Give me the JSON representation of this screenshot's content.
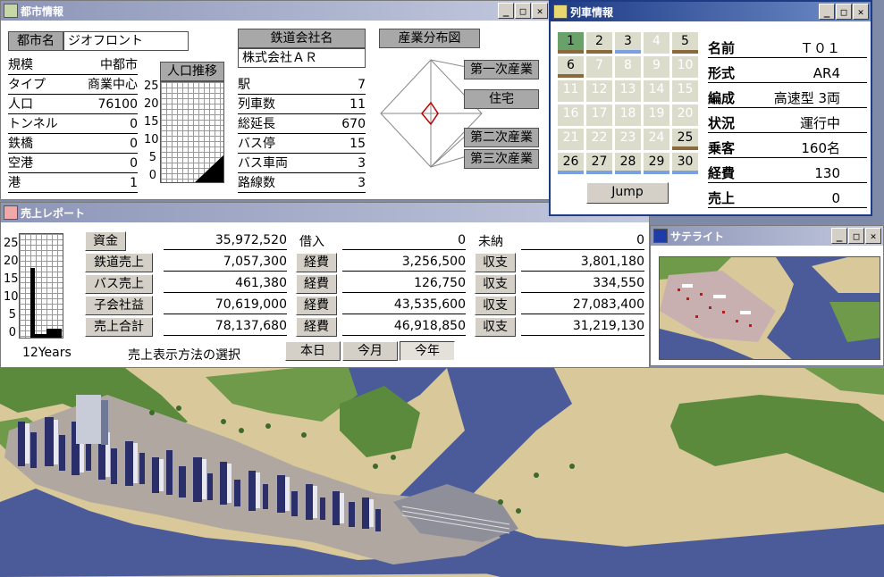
{
  "city_window": {
    "title": "都市情報",
    "city_name_label": "都市名",
    "city_name": "ジオフロント",
    "stats": [
      {
        "label": "規模",
        "value": "中都市"
      },
      {
        "label": "タイプ",
        "value": "商業中心"
      },
      {
        "label": "人口",
        "value": "76100"
      },
      {
        "label": "トンネル",
        "value": "0"
      },
      {
        "label": "鉄橋",
        "value": "0"
      },
      {
        "label": "空港",
        "value": "0"
      },
      {
        "label": "港",
        "value": "1"
      }
    ],
    "population_chart_label": "人口推移",
    "population_axis": [
      "25",
      "20",
      "15",
      "10",
      "5",
      "0"
    ],
    "railway_company_label": "鉄道会社名",
    "railway_company": "株式会社ＡＲ",
    "rail_stats": [
      {
        "label": "駅",
        "value": "7"
      },
      {
        "label": "列車数",
        "value": "11"
      },
      {
        "label": "総延長",
        "value": "670"
      },
      {
        "label": "バス停",
        "value": "15"
      },
      {
        "label": "バス車両",
        "value": "3"
      },
      {
        "label": "路線数",
        "value": "3"
      }
    ],
    "industry_map_label": "産業分布図",
    "industry_labels": [
      "第一次産業",
      "住宅",
      "第二次産業",
      "第三次産業"
    ]
  },
  "train_window": {
    "title": "列車情報",
    "cells": [
      {
        "n": "1",
        "state": "sel",
        "bar": "#8a6a3a"
      },
      {
        "n": "2",
        "state": "on",
        "bar": "#8a6a3a"
      },
      {
        "n": "3",
        "state": "on",
        "bar": "#7aa0e0"
      },
      {
        "n": "4",
        "state": "dim",
        "bar": ""
      },
      {
        "n": "5",
        "state": "on",
        "bar": "#8a6a3a"
      },
      {
        "n": "6",
        "state": "on",
        "bar": "#8a6a3a"
      },
      {
        "n": "7",
        "state": "dim",
        "bar": ""
      },
      {
        "n": "8",
        "state": "dim",
        "bar": ""
      },
      {
        "n": "9",
        "state": "dim",
        "bar": ""
      },
      {
        "n": "10",
        "state": "dim",
        "bar": ""
      },
      {
        "n": "11",
        "state": "dim",
        "bar": ""
      },
      {
        "n": "12",
        "state": "dim",
        "bar": ""
      },
      {
        "n": "13",
        "state": "dim",
        "bar": ""
      },
      {
        "n": "14",
        "state": "dim",
        "bar": ""
      },
      {
        "n": "15",
        "state": "dim",
        "bar": ""
      },
      {
        "n": "16",
        "state": "dim",
        "bar": ""
      },
      {
        "n": "17",
        "state": "dim",
        "bar": ""
      },
      {
        "n": "18",
        "state": "dim",
        "bar": ""
      },
      {
        "n": "19",
        "state": "dim",
        "bar": ""
      },
      {
        "n": "20",
        "state": "dim",
        "bar": ""
      },
      {
        "n": "21",
        "state": "dim",
        "bar": ""
      },
      {
        "n": "22",
        "state": "dim",
        "bar": ""
      },
      {
        "n": "23",
        "state": "dim",
        "bar": ""
      },
      {
        "n": "24",
        "state": "dim",
        "bar": ""
      },
      {
        "n": "25",
        "state": "on",
        "bar": "#8a6a3a"
      },
      {
        "n": "26",
        "state": "on",
        "bar": "#7aa0e0"
      },
      {
        "n": "27",
        "state": "on",
        "bar": "#7aa0e0"
      },
      {
        "n": "28",
        "state": "on",
        "bar": "#7aa0e0"
      },
      {
        "n": "29",
        "state": "on",
        "bar": "#7aa0e0"
      },
      {
        "n": "30",
        "state": "on",
        "bar": "#7aa0e0"
      }
    ],
    "jump_label": "Jump",
    "info": [
      {
        "label": "名前",
        "value": "Ｔ０１"
      },
      {
        "label": "形式",
        "value": "AR4"
      },
      {
        "label": "編成",
        "value": "高速型 3両"
      },
      {
        "label": "状況",
        "value": "運行中"
      },
      {
        "label": "乗客",
        "value": "160名"
      },
      {
        "label": "経費",
        "value": "130"
      },
      {
        "label": "売上",
        "value": "0"
      }
    ]
  },
  "sales_window": {
    "title": "売上レポート",
    "chart_axis": [
      "25",
      "20",
      "15",
      "10",
      "5",
      "0"
    ],
    "chart_caption": "12Years",
    "select_label": "売上表示方法の選択",
    "period_buttons": [
      "本日",
      "今月",
      "今年"
    ],
    "rows": [
      {
        "label": "資金",
        "value": "35,972,520",
        "mid_label": "借入",
        "mid_value": "0",
        "right_label": "未納",
        "right_value": "0"
      },
      {
        "label": "鉄道売上",
        "value": "7,057,300",
        "mid_label": "経費",
        "mid_value": "3,256,500",
        "right_label": "収支",
        "right_value": "3,801,180"
      },
      {
        "label": "バス売上",
        "value": "461,380",
        "mid_label": "経費",
        "mid_value": "126,750",
        "right_label": "収支",
        "right_value": "334,550"
      },
      {
        "label": "子会社益",
        "value": "70,619,000",
        "mid_label": "経費",
        "mid_value": "43,535,600",
        "right_label": "収支",
        "right_value": "27,083,400"
      },
      {
        "label": "売上合計",
        "value": "78,137,680",
        "mid_label": "経費",
        "mid_value": "46,918,850",
        "right_label": "収支",
        "right_value": "31,219,130"
      }
    ]
  },
  "satellite_window": {
    "title": "サテライト"
  },
  "colors": {
    "ground": "#d8c89a",
    "water": "#4b5a98",
    "grass": "#6e9a4a",
    "hill": "#5b8a3c"
  }
}
